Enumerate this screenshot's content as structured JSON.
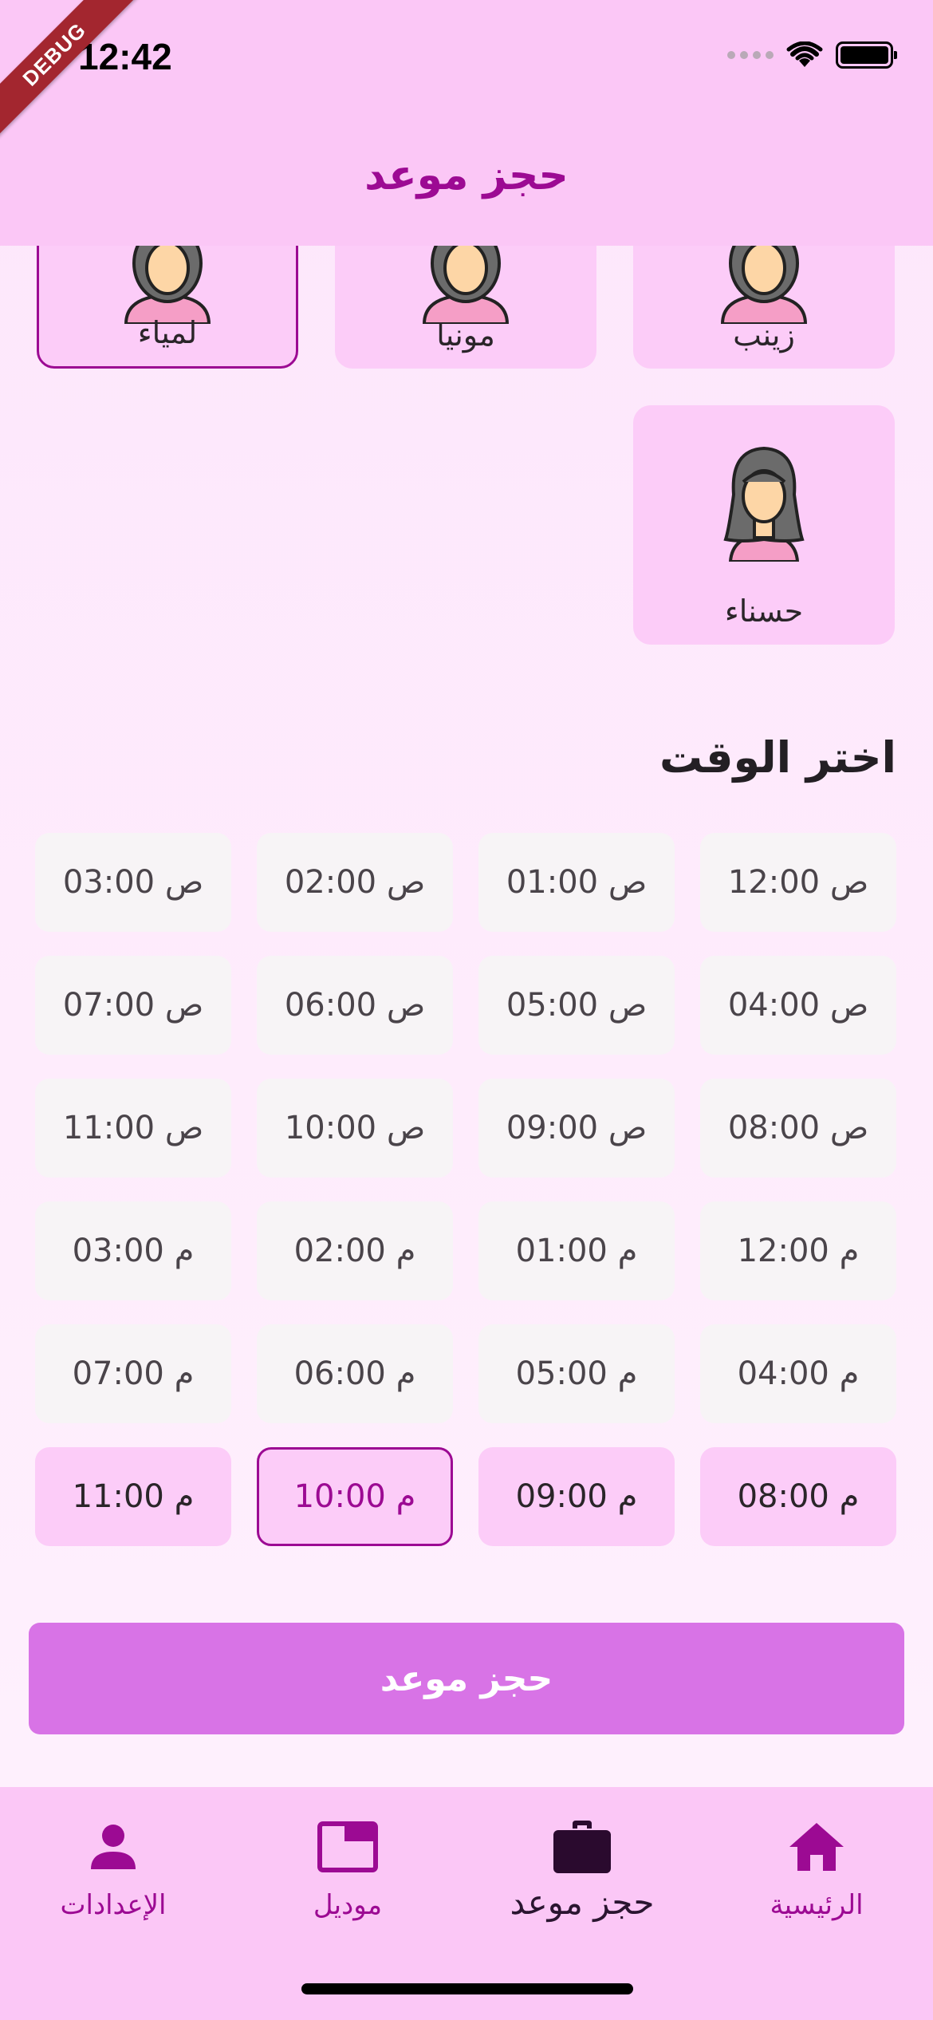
{
  "status_bar": {
    "time": "12:42",
    "debug_label": "DEBUG"
  },
  "app_bar": {
    "title": "حجز موعد"
  },
  "stylists": [
    {
      "name": "زينب",
      "selected": false
    },
    {
      "name": "مونيا",
      "selected": false
    },
    {
      "name": "لمياء",
      "selected": true
    },
    {
      "name": "حسناء",
      "selected": false
    }
  ],
  "time_section": {
    "title": "اختر الوقت",
    "slots": [
      "12:00 ص",
      "01:00 ص",
      "02:00 ص",
      "03:00 ص",
      "04:00 ص",
      "05:00 ص",
      "06:00 ص",
      "07:00 ص",
      "08:00 ص",
      "09:00 ص",
      "10:00 ص",
      "11:00 ص",
      "12:00 م",
      "01:00 م",
      "02:00 م",
      "03:00 م",
      "04:00 م",
      "05:00 م",
      "06:00 م",
      "07:00 م",
      "08:00 م",
      "09:00 م",
      "10:00 م",
      "11:00 م"
    ],
    "selected": "10:00 م"
  },
  "book_button": {
    "label": "حجز موعد"
  },
  "bottom_nav": {
    "items": [
      {
        "label": "الرئيسية",
        "icon": "home-icon",
        "active": false
      },
      {
        "label": "حجز موعد",
        "icon": "briefcase-icon",
        "active": true
      },
      {
        "label": "موديل",
        "icon": "window-icon",
        "active": false
      },
      {
        "label": "الإعدادات",
        "icon": "person-icon",
        "active": false
      }
    ]
  },
  "colors": {
    "accent": "#9c0a93",
    "appbar": "#fbc7f6",
    "card": "#fcccf8",
    "button": "#d873e6",
    "slot_disabled": "#f7f4f6"
  }
}
